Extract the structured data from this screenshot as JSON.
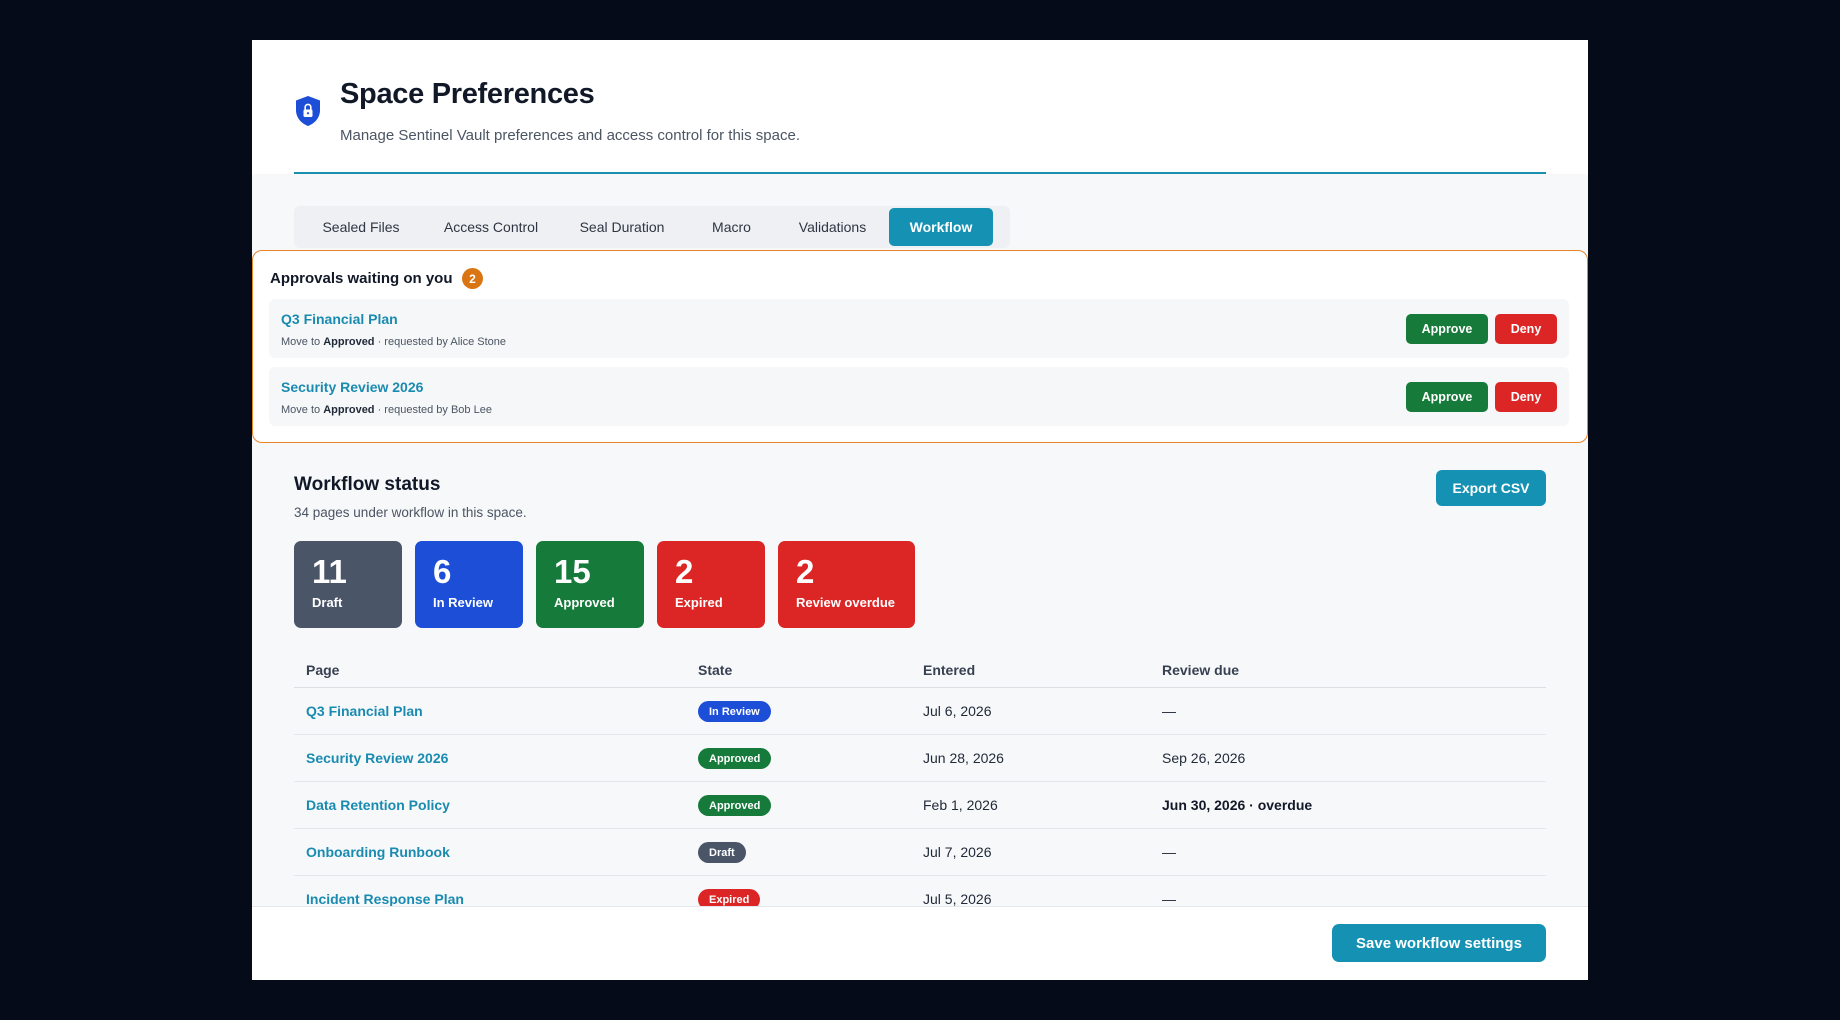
{
  "header": {
    "title": "Space Preferences",
    "subtitle": "Manage Sentinel Vault preferences and access control for this space.",
    "icon": "shield-lock-icon",
    "accent_color": "#1592b3"
  },
  "tabs": [
    {
      "label": "Sealed Files",
      "active": false
    },
    {
      "label": "Access Control",
      "active": false
    },
    {
      "label": "Seal Duration",
      "active": false
    },
    {
      "label": "Macro",
      "active": false
    },
    {
      "label": "Validations",
      "active": false
    },
    {
      "label": "Workflow",
      "active": true
    }
  ],
  "approvals": {
    "title": "Approvals waiting on you",
    "count": "2",
    "items": [
      {
        "name": "Q3 Financial Plan",
        "meta_prefix": "Move to ",
        "meta_state": "Approved",
        "meta_suffix": " · requested by Alice Stone",
        "approve_label": "Approve",
        "deny_label": "Deny"
      },
      {
        "name": "Security Review 2026",
        "meta_prefix": "Move to ",
        "meta_state": "Approved",
        "meta_suffix": " · requested by Bob Lee",
        "approve_label": "Approve",
        "deny_label": "Deny"
      }
    ]
  },
  "status": {
    "title": "Workflow status",
    "subtitle": "34 pages under workflow in this space.",
    "export_label": "Export CSV",
    "stats": [
      {
        "value": "11",
        "label": "Draft",
        "color": "#4a5568"
      },
      {
        "value": "6",
        "label": "In Review",
        "color": "#1d4ed8"
      },
      {
        "value": "15",
        "label": "Approved",
        "color": "#167a3a"
      },
      {
        "value": "2",
        "label": "Expired",
        "color": "#dc2626"
      },
      {
        "value": "2",
        "label": "Review overdue",
        "color": "#dc2626"
      }
    ]
  },
  "table": {
    "columns": [
      "Page",
      "State",
      "Entered",
      "Review due"
    ],
    "rows": [
      {
        "page": "Q3 Financial Plan",
        "state": "In Review",
        "state_color": "#1d4ed8",
        "entered": "Jul 6, 2026",
        "due": "—",
        "due_bold": false
      },
      {
        "page": "Security Review 2026",
        "state": "Approved",
        "state_color": "#167a3a",
        "entered": "Jun 28, 2026",
        "due": "Sep 26, 2026",
        "due_bold": false
      },
      {
        "page": "Data Retention Policy",
        "state": "Approved",
        "state_color": "#167a3a",
        "entered": "Feb 1, 2026",
        "due": "Jun 30, 2026 · overdue",
        "due_bold": true
      },
      {
        "page": "Onboarding Runbook",
        "state": "Draft",
        "state_color": "#4a5568",
        "entered": "Jul 7, 2026",
        "due": "—",
        "due_bold": false
      },
      {
        "page": "Incident Response Plan",
        "state": "Expired",
        "state_color": "#dc2626",
        "entered": "Jul 5, 2026",
        "due": "—",
        "due_bold": false
      }
    ]
  },
  "footer": {
    "save_label": "Save workflow settings"
  }
}
